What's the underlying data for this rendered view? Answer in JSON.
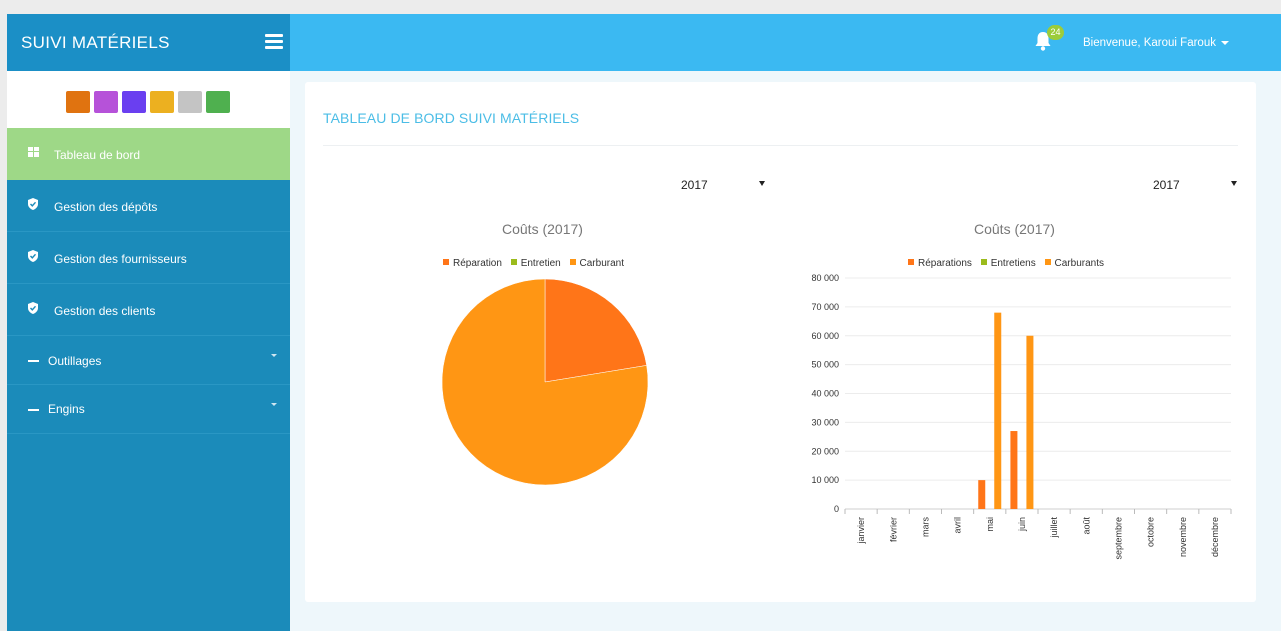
{
  "header": {
    "brand": "SUIVI MATÉRIELS",
    "notifications": "24",
    "user_greeting": "Bienvenue, Karoui Farouk"
  },
  "theme_swatches": [
    "#e07310",
    "#b652d9",
    "#6a3ff0",
    "#ecb020",
    "#c4c4c4",
    "#4fb04f"
  ],
  "sidebar": {
    "items": [
      {
        "label": "Tableau de bord",
        "icon": "dashboard-icon",
        "active": true
      },
      {
        "label": "Gestion des dépôts",
        "icon": "shield-icon"
      },
      {
        "label": "Gestion des fournisseurs",
        "icon": "shield-icon"
      },
      {
        "label": "Gestion des clients",
        "icon": "shield-icon"
      },
      {
        "label": "Outillages",
        "icon": "dash-icon",
        "submenu": true
      },
      {
        "label": "Engins",
        "icon": "dash-icon",
        "submenu": true
      }
    ]
  },
  "main": {
    "title": "TABLEAU DE BORD SUIVI MATÉRIELS",
    "left_year": "2017",
    "right_year": "2017"
  },
  "colors": {
    "reparation": "#ff7518",
    "entretien": "#9bbb1c",
    "carburant": "#ff9614"
  },
  "chart_data": [
    {
      "type": "pie",
      "title": "Coûts (2017)",
      "legend": [
        "Réparation",
        "Entretien",
        "Carburant"
      ],
      "values": [
        37000,
        0,
        128000
      ],
      "legend_position": "top"
    },
    {
      "type": "bar",
      "title": "Coûts (2017)",
      "legend_position": "top",
      "categories": [
        "janvier",
        "février",
        "mars",
        "avril",
        "mai",
        "juin",
        "juillet",
        "août",
        "septembre",
        "octobre",
        "novembre",
        "décembre"
      ],
      "series": [
        {
          "name": "Réparations",
          "values": [
            0,
            0,
            0,
            0,
            10000,
            27000,
            0,
            0,
            0,
            0,
            0,
            0
          ]
        },
        {
          "name": "Entretiens",
          "values": [
            0,
            0,
            0,
            0,
            0,
            0,
            0,
            0,
            0,
            0,
            0,
            0
          ]
        },
        {
          "name": "Carburants",
          "values": [
            0,
            0,
            0,
            0,
            68000,
            60000,
            0,
            0,
            0,
            0,
            0,
            0
          ]
        }
      ],
      "ylim": [
        0,
        80000
      ],
      "yticks": [
        0,
        10000,
        20000,
        30000,
        40000,
        50000,
        60000,
        70000,
        80000
      ],
      "ytick_labels": [
        "0",
        "10 000",
        "20 000",
        "30 000",
        "40 000",
        "50 000",
        "60 000",
        "70 000",
        "80 000"
      ],
      "grid": true
    }
  ]
}
